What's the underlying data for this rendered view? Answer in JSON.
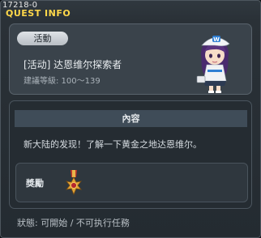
{
  "window": {
    "id": "17218-0",
    "title": "QUEST INFO"
  },
  "quest": {
    "tag": "活動",
    "name": "[活动] 达恩维尔探索者",
    "level": "建議等級: 100～139"
  },
  "content": {
    "header": "內容",
    "text": "新大陆的发现！了解一下黄金之地达恩维尔。"
  },
  "reward": {
    "label": "獎勵",
    "icon": "medal-icon"
  },
  "status": "狀態: 可開始 / 不可执行任務",
  "colors": {
    "title": "#ffd84a",
    "header_bar": "#3f4c58",
    "panel": "#3a434b"
  }
}
